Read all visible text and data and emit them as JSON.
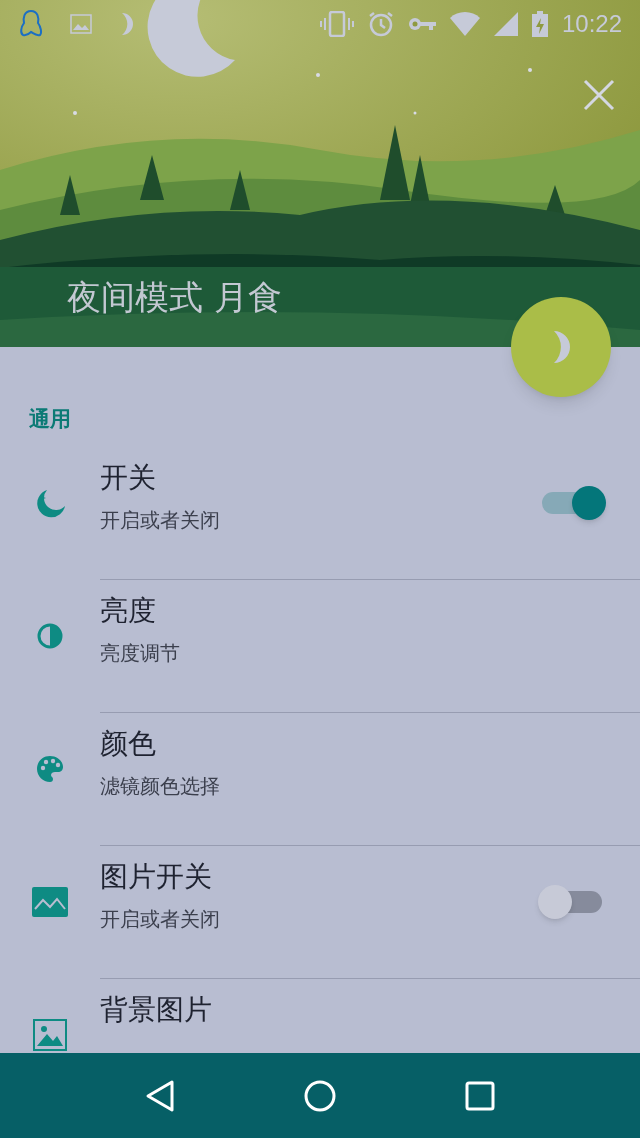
{
  "status_bar": {
    "time": "10:22"
  },
  "header": {
    "title": "夜间模式 月食"
  },
  "section": {
    "label": "通用"
  },
  "settings": [
    {
      "kind": "toggle",
      "title": "开关",
      "subtitle": "开启或者关闭",
      "on": true
    },
    {
      "kind": "link",
      "title": "亮度",
      "subtitle": "亮度调节"
    },
    {
      "kind": "link",
      "title": "颜色",
      "subtitle": "滤镜颜色选择"
    },
    {
      "kind": "toggle",
      "title": "图片开关",
      "subtitle": "开启或者关闭",
      "on": false
    },
    {
      "kind": "link",
      "title": "背景图片"
    }
  ]
}
